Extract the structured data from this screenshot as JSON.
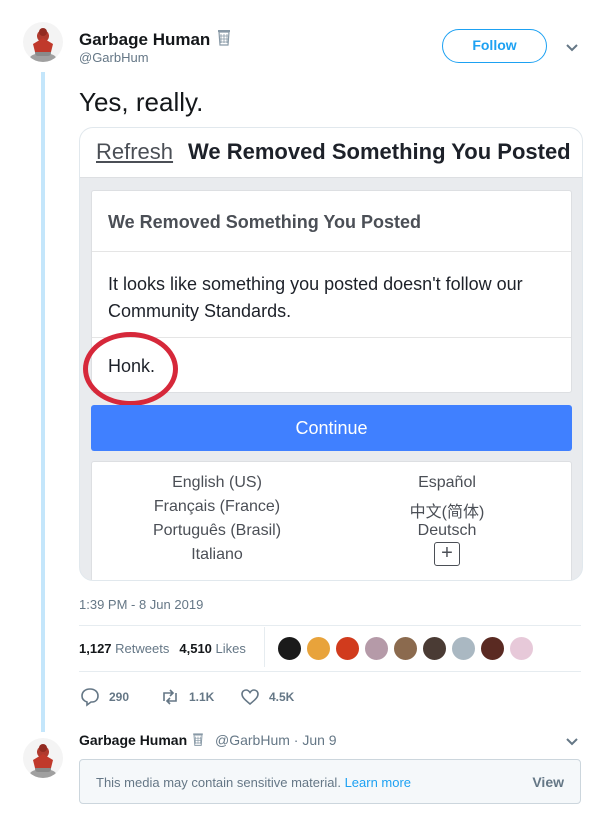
{
  "tweet": {
    "author_name": "Garbage Human",
    "author_handle": "@GarbHum",
    "follow_label": "Follow",
    "text": "Yes, really.",
    "timestamp": "1:39 PM - 8 Jun 2019",
    "retweets_count": "1,127",
    "retweets_label": "Retweets",
    "likes_count": "4,510",
    "likes_label": "Likes",
    "actions": {
      "reply_count": "290",
      "retweet_count": "1.1K",
      "like_count": "4.5K"
    }
  },
  "media": {
    "refresh_label": "Refresh",
    "header_title": "We Removed Something You Posted",
    "card_title": "We Removed Something You Posted",
    "card_body": "It looks like something you posted doesn't follow our Community Standards.",
    "post_text": "Honk.",
    "continue_label": "Continue",
    "languages": {
      "left": [
        "English (US)",
        "Français (France)",
        "Português (Brasil)",
        "Italiano"
      ],
      "right": [
        "Español",
        "中文(简体)",
        "Deutsch"
      ],
      "more_symbol": "+"
    }
  },
  "reply": {
    "author_name": "Garbage Human",
    "meta": "@GarbHum · Jun 9",
    "sensitive_text": "This media may contain sensitive material.",
    "learn_more": "Learn more",
    "view_label": "View"
  },
  "colors": {
    "twitter_blue": "#1da1f2",
    "facebook_blue": "#4080ff",
    "highlight_red": "#d6283a",
    "thread_line": "#c4e6fb"
  }
}
